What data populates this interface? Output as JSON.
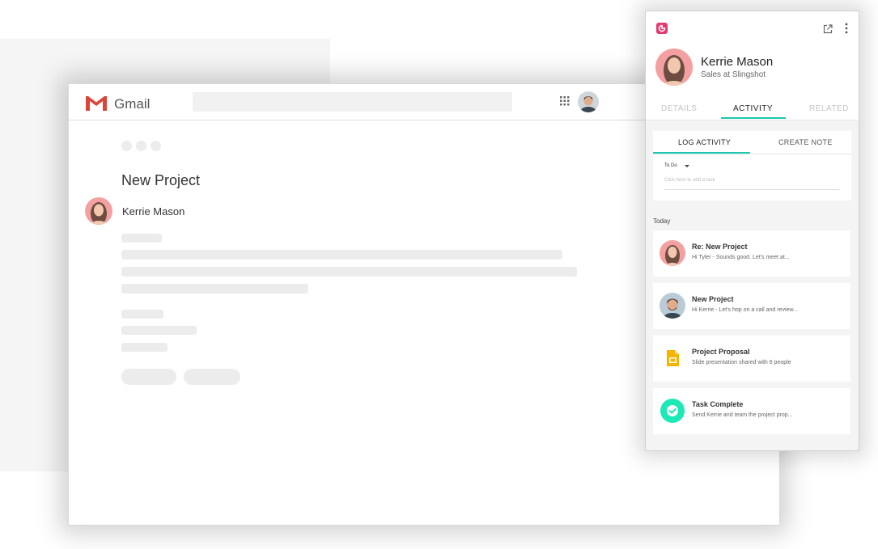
{
  "gmail": {
    "app_name": "Gmail",
    "subject": "New Project",
    "sender": "Kerrie Mason"
  },
  "crm": {
    "contact_name": "Kerrie Mason",
    "contact_role": "Sales at Slingshot",
    "tabs": [
      "DETAILS",
      "ACTIVITY",
      "RELATED"
    ],
    "active_tab": "ACTIVITY",
    "sub_tabs": [
      "LOG ACTIVITY",
      "CREATE NOTE"
    ],
    "todo_label": "To Do",
    "task_placeholder": "Click here to add a task",
    "section_label": "Today",
    "activities": [
      {
        "title": "Re: New Project",
        "subtitle": "Hi Tyler - Sounds good. Let's meet at...",
        "icon": "avatar-kerrie"
      },
      {
        "title": "New Project",
        "subtitle": "Hi Kerrie - Let's hop on a call and review...",
        "icon": "avatar-tyler"
      },
      {
        "title": "Project Proposal",
        "subtitle": "Slide presentation shared with 6 people",
        "icon": "slides-icon"
      },
      {
        "title": "Task Complete",
        "subtitle": "Send Kerrie and team the project prop...",
        "icon": "check-circle-icon"
      }
    ],
    "colors": {
      "accent": "#1ec9b0",
      "brand": "#e53a6e",
      "slides": "#f4b400"
    }
  }
}
